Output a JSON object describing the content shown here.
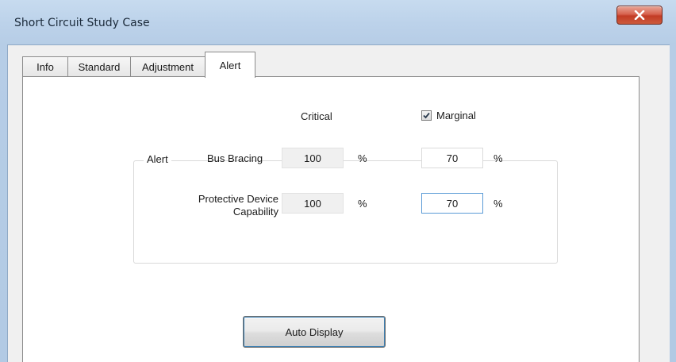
{
  "window": {
    "title": "Short Circuit Study Case"
  },
  "tabs": [
    {
      "label": "Info"
    },
    {
      "label": "Standard"
    },
    {
      "label": "Adjustment"
    },
    {
      "label": "Alert"
    }
  ],
  "alert_panel": {
    "critical_label": "Critical",
    "marginal_label": "Marginal",
    "marginal_checked": true,
    "group_title": "Alert",
    "rows": [
      {
        "label_line1": "Bus Bracing",
        "label_line2": "",
        "critical_value": "100",
        "critical_unit": "%",
        "marginal_value": "70",
        "marginal_unit": "%"
      },
      {
        "label_line1": "Protective Device",
        "label_line2": "Capability",
        "critical_value": "100",
        "critical_unit": "%",
        "marginal_value": "70",
        "marginal_unit": "%"
      }
    ],
    "auto_display_label": "Auto Display"
  },
  "colors": {
    "title_bar": "#bcd2ea",
    "close_button": "#c94a31",
    "focus_border": "#5b9bd6"
  }
}
